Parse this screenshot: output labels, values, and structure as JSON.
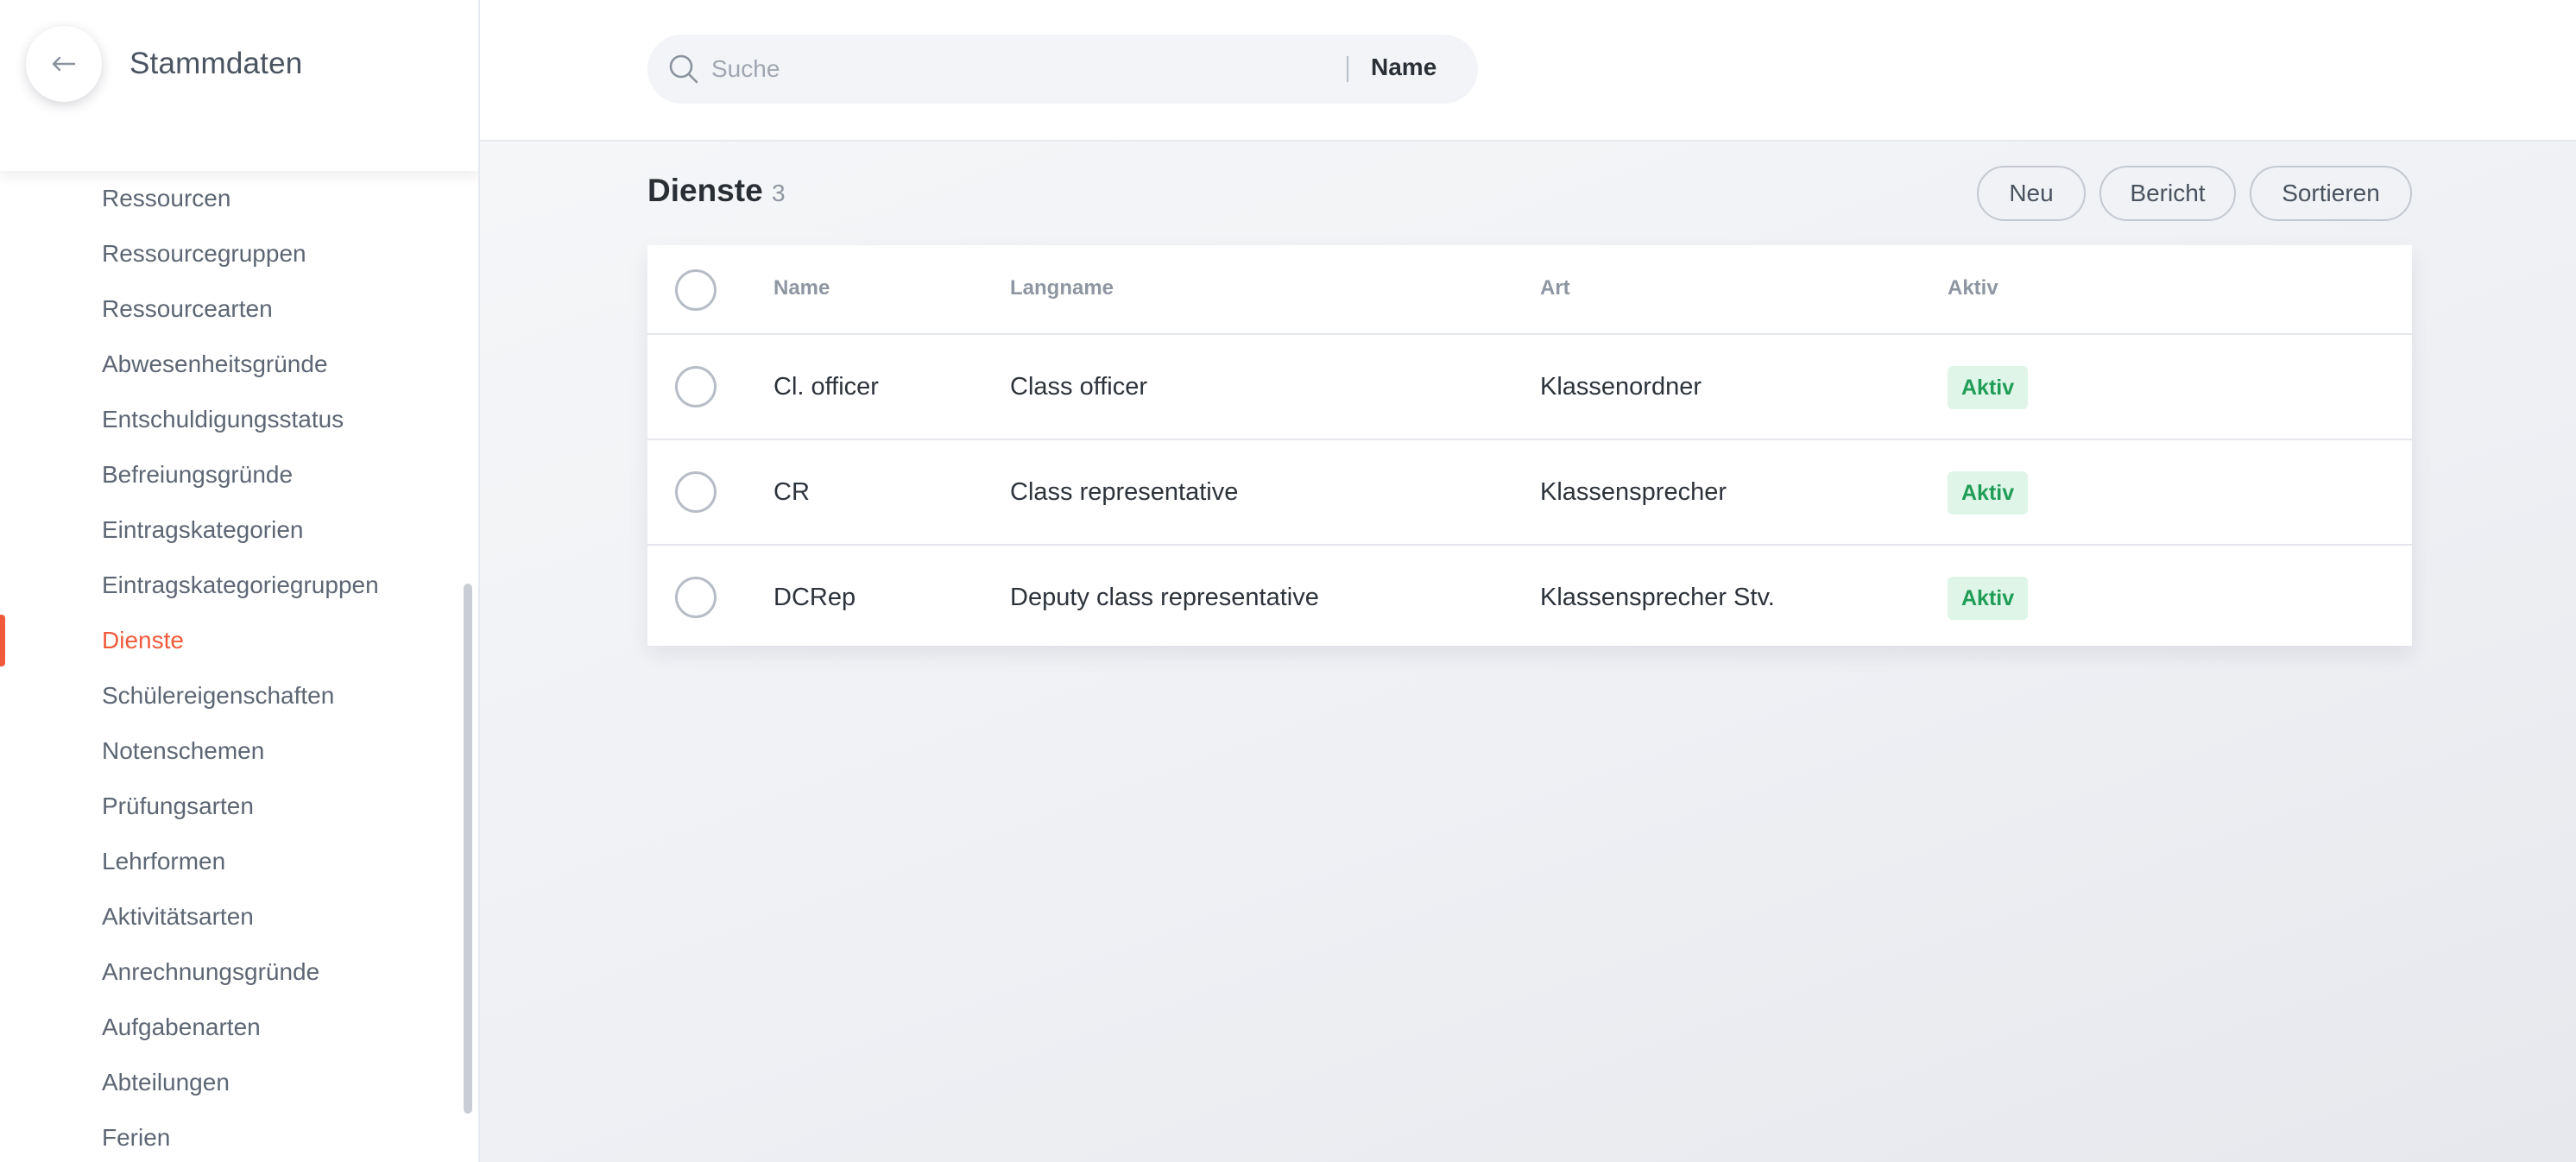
{
  "sidebar": {
    "title": "Stammdaten",
    "items": [
      {
        "label": "Ressourcen"
      },
      {
        "label": "Ressourcegruppen"
      },
      {
        "label": "Ressourcearten"
      },
      {
        "label": "Abwesenheitsgründe"
      },
      {
        "label": "Entschuldigungsstatus"
      },
      {
        "label": "Befreiungsgründe"
      },
      {
        "label": "Eintragskategorien"
      },
      {
        "label": "Eintragskategoriegruppen"
      },
      {
        "label": "Dienste",
        "active": true
      },
      {
        "label": "Schülereigenschaften"
      },
      {
        "label": "Notenschemen"
      },
      {
        "label": "Prüfungsarten"
      },
      {
        "label": "Lehrformen"
      },
      {
        "label": "Aktivitätsarten"
      },
      {
        "label": "Anrechnungsgründe"
      },
      {
        "label": "Aufgabenarten"
      },
      {
        "label": "Abteilungen"
      },
      {
        "label": "Ferien"
      }
    ]
  },
  "search": {
    "placeholder": "Suche",
    "value": "",
    "field": "Name"
  },
  "page": {
    "title": "Dienste",
    "count": "3"
  },
  "actions": {
    "new_label": "Neu",
    "report_label": "Bericht",
    "sort_label": "Sortieren"
  },
  "table": {
    "columns": {
      "name": "Name",
      "langname": "Langname",
      "art": "Art",
      "aktiv": "Aktiv"
    },
    "rows": [
      {
        "name": "Cl. officer",
        "langname": "Class officer",
        "art": "Klassenordner",
        "aktiv": "Aktiv"
      },
      {
        "name": "CR",
        "langname": "Class representative",
        "art": "Klassensprecher",
        "aktiv": "Aktiv"
      },
      {
        "name": "DCRep",
        "langname": "Deputy class representative",
        "art": "Klassensprecher Stv.",
        "aktiv": "Aktiv"
      }
    ]
  },
  "colors": {
    "accent": "#f05a3a",
    "status_active_bg": "#dff5e8",
    "status_active_text": "#1f9d57"
  },
  "icons": {
    "back": "arrow-left-icon",
    "search": "search-icon"
  }
}
